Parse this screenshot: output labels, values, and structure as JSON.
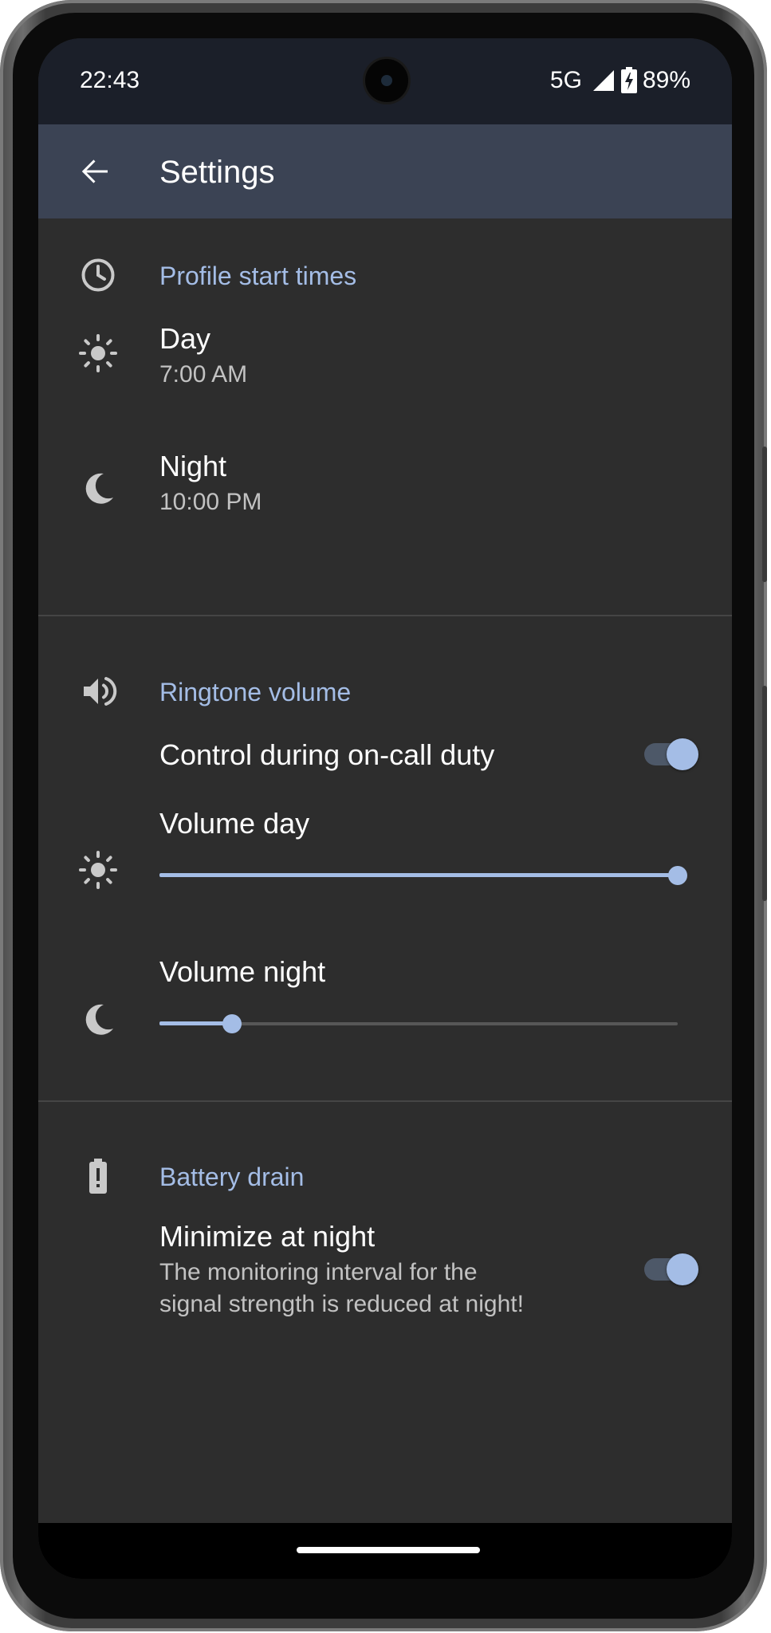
{
  "status_bar": {
    "time": "22:43",
    "network": "5G",
    "battery": "89%",
    "signal_icon": "signal-icon",
    "battery_icon": "battery-charging-icon"
  },
  "app_bar": {
    "title": "Settings",
    "back_icon": "arrow-back-icon"
  },
  "sections": {
    "profile_start_times": {
      "title": "Profile start times",
      "icon": "clock-icon",
      "day": {
        "label": "Day",
        "value": "7:00 AM",
        "icon": "sun-icon"
      },
      "night": {
        "label": "Night",
        "value": "10:00 PM",
        "icon": "moon-icon"
      }
    },
    "ringtone_volume": {
      "title": "Ringtone volume",
      "icon": "volume-icon",
      "control_on_call": {
        "label": "Control during on-call duty",
        "enabled": true
      },
      "volume_day": {
        "label": "Volume day",
        "level": 1.0,
        "icon": "sun-icon"
      },
      "volume_night": {
        "label": "Volume night",
        "level": 0.14,
        "icon": "moon-icon"
      }
    },
    "battery_drain": {
      "title": "Battery drain",
      "icon": "battery-alert-icon",
      "minimize_at_night": {
        "label": "Minimize at night",
        "summary_line1": "The monitoring interval for the",
        "summary_line2": "signal strength is reduced at night!",
        "enabled": true
      }
    }
  },
  "colors": {
    "accent": "#a4bde6",
    "background": "#2d2d2d",
    "app_bar": "#3b4354",
    "status_bar": "#1b1f29"
  }
}
